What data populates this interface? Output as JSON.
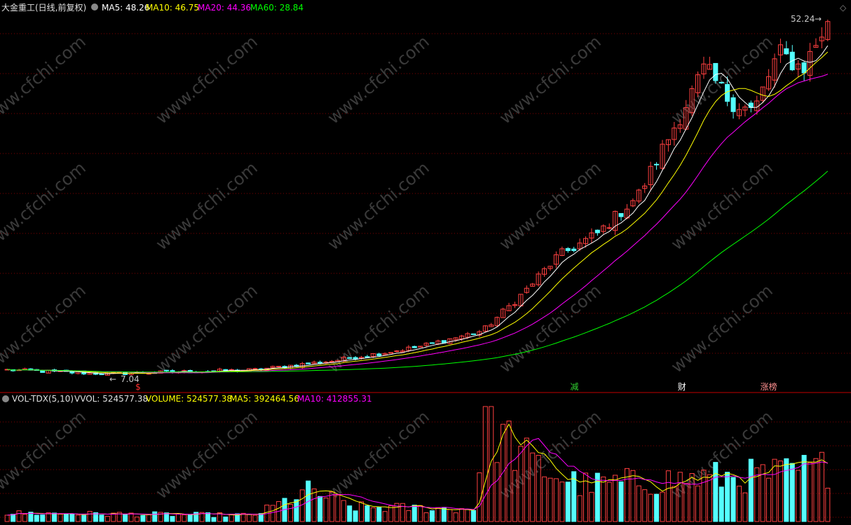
{
  "price_header": {
    "title": "大金重工(日线,前复权)",
    "ma5": "MA5: 48.26",
    "ma10": "MA10: 46.75",
    "ma20": "MA20: 44.36",
    "ma60": "MA60: 28.84"
  },
  "vol_header": {
    "indicator": "VOL-TDX(5,10)",
    "vvol": "VVOL: 524577.38",
    "volume": "VOLUME: 524577.38",
    "ma5": "MA5: 392464.56",
    "ma10": "MA10: 412855.31"
  },
  "annotations": {
    "high": "52.24",
    "low": "7.04",
    "markers": [
      {
        "text": "$",
        "pos": 0.162,
        "color": "#ff3030"
      },
      {
        "text": "减",
        "pos": 0.69,
        "color": "#30d030"
      },
      {
        "text": "财",
        "pos": 0.82,
        "color": "#ffffff"
      },
      {
        "text": "涨榜",
        "pos": 0.925,
        "color": "#ff9090"
      }
    ]
  },
  "watermark": "www.cfchi.com",
  "colors": {
    "up": "#ff4040",
    "down": "#54ffff",
    "ma5": "#ffffff",
    "ma10": "#ffff00",
    "ma20": "#ff00ff",
    "ma60": "#00ff00",
    "grid": "#800000"
  },
  "chart_data": {
    "type": "candlestick",
    "y_range": [
      7.04,
      52.24
    ],
    "key_points": [
      {
        "t": 0.0,
        "close": 7.6
      },
      {
        "t": 0.12,
        "close": 7.1
      },
      {
        "t": 0.3,
        "close": 7.6
      },
      {
        "t": 0.4,
        "close": 8.8
      },
      {
        "t": 0.5,
        "close": 10.5
      },
      {
        "t": 0.58,
        "close": 12.6
      },
      {
        "t": 0.63,
        "close": 17.5
      },
      {
        "t": 0.67,
        "close": 22.0
      },
      {
        "t": 0.72,
        "close": 25.0
      },
      {
        "t": 0.77,
        "close": 30.0
      },
      {
        "t": 0.81,
        "close": 38.0
      },
      {
        "t": 0.85,
        "close": 46.0
      },
      {
        "t": 0.88,
        "close": 42.0
      },
      {
        "t": 0.91,
        "close": 40.5
      },
      {
        "t": 0.94,
        "close": 48.0
      },
      {
        "t": 0.97,
        "close": 46.0
      },
      {
        "t": 1.0,
        "close": 52.0
      }
    ],
    "volume_key_points": [
      {
        "t": 0.0,
        "v": 0.08
      },
      {
        "t": 0.3,
        "v": 0.06
      },
      {
        "t": 0.37,
        "v": 0.3
      },
      {
        "t": 0.42,
        "v": 0.14
      },
      {
        "t": 0.57,
        "v": 0.12
      },
      {
        "t": 0.58,
        "v": 1.0
      },
      {
        "t": 0.64,
        "v": 0.55
      },
      {
        "t": 0.7,
        "v": 0.35
      },
      {
        "t": 0.85,
        "v": 0.42
      },
      {
        "t": 0.93,
        "v": 0.45
      },
      {
        "t": 1.0,
        "v": 0.52
      }
    ]
  }
}
